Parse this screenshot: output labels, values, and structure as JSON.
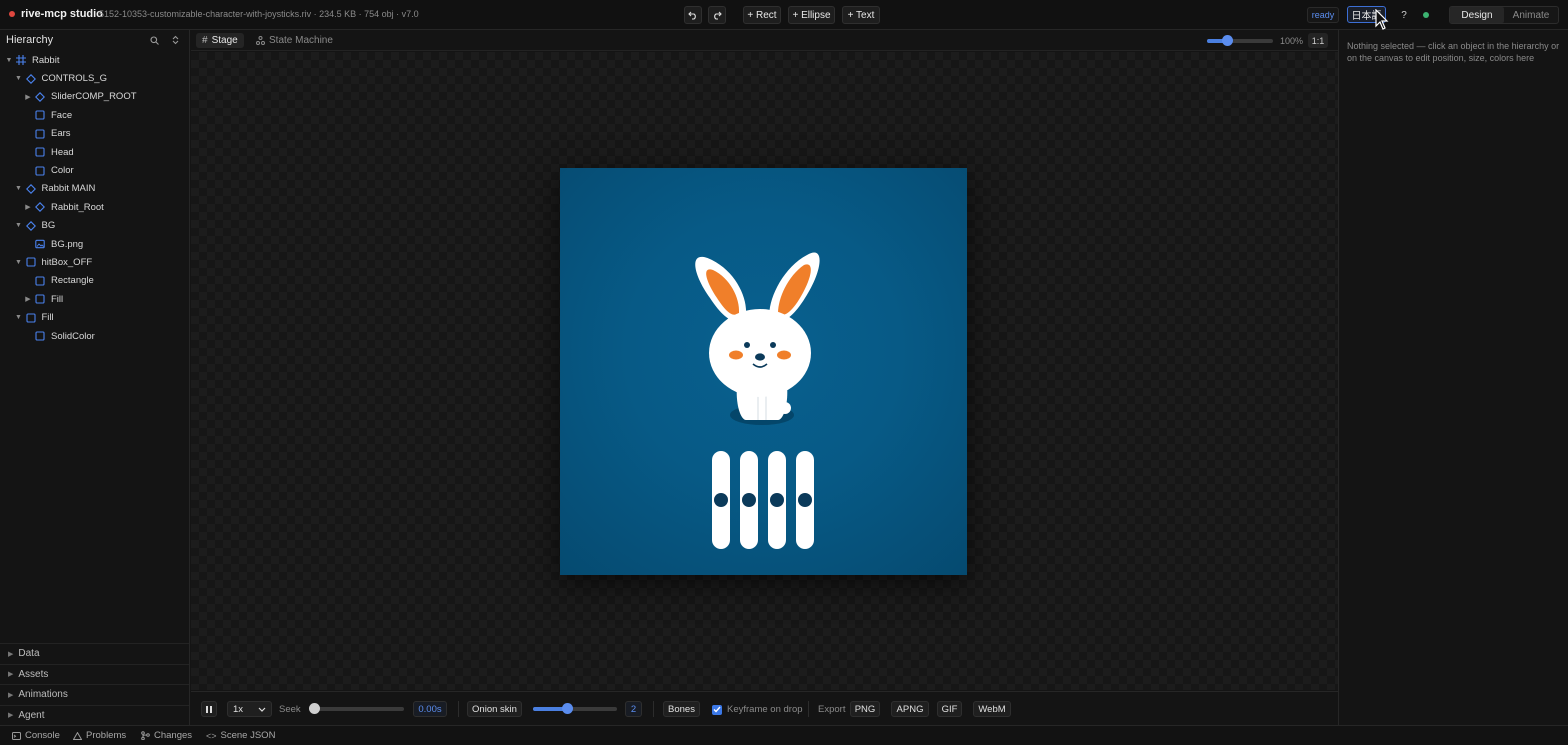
{
  "app": {
    "name": "rive-mcp studio",
    "file_info": "5152-10353-customizable-character-with-joysticks.riv · 234.5 KB · 754 obj · v7.0"
  },
  "toolbar": {
    "undo_icon": "undo-icon",
    "redo_icon": "redo-icon",
    "add_rect": "+ Rect",
    "add_ellipse": "+ Ellipse",
    "add_text": "+ Text",
    "status": "ready",
    "language": "日本語",
    "help": "?",
    "status_color": "#3cb371"
  },
  "modes": {
    "design": "Design",
    "animate": "Animate",
    "active": "Design"
  },
  "hierarchy": {
    "title": "Hierarchy",
    "items": [
      {
        "label": "Rabbit",
        "depth": 0,
        "toggle": "open",
        "icon": "artboard-icon"
      },
      {
        "label": "CONTROLS_G",
        "depth": 1,
        "toggle": "open",
        "icon": "group-icon"
      },
      {
        "label": "SliderCOMP_ROOT",
        "depth": 2,
        "toggle": "closed",
        "icon": "group-icon"
      },
      {
        "label": "Face",
        "depth": 2,
        "toggle": "none",
        "icon": "shape-icon"
      },
      {
        "label": "Ears",
        "depth": 2,
        "toggle": "none",
        "icon": "shape-icon"
      },
      {
        "label": "Head",
        "depth": 2,
        "toggle": "none",
        "icon": "shape-icon"
      },
      {
        "label": "Color",
        "depth": 2,
        "toggle": "none",
        "icon": "shape-icon"
      },
      {
        "label": "Rabbit MAIN",
        "depth": 1,
        "toggle": "open",
        "icon": "group-icon"
      },
      {
        "label": "Rabbit_Root",
        "depth": 2,
        "toggle": "closed",
        "icon": "group-icon"
      },
      {
        "label": "BG",
        "depth": 1,
        "toggle": "open",
        "icon": "group-icon"
      },
      {
        "label": "BG.png",
        "depth": 2,
        "toggle": "none",
        "icon": "image-icon"
      },
      {
        "label": "hitBox_OFF",
        "depth": 1,
        "toggle": "open",
        "icon": "shape-icon"
      },
      {
        "label": "Rectangle",
        "depth": 2,
        "toggle": "none",
        "icon": "shape-icon"
      },
      {
        "label": "Fill",
        "depth": 2,
        "toggle": "closed",
        "icon": "shape-icon"
      },
      {
        "label": "Fill",
        "depth": 1,
        "toggle": "open",
        "icon": "shape-icon"
      },
      {
        "label": "SolidColor",
        "depth": 2,
        "toggle": "none",
        "icon": "shape-icon"
      }
    ]
  },
  "sections": [
    "Data",
    "Assets",
    "Animations",
    "Agent"
  ],
  "stage": {
    "tabs": {
      "stage": "Stage",
      "state_machine": "State Machine"
    },
    "zoom": "100%",
    "zoom_fraction": 0.3,
    "one_to_one": "1:1",
    "artboard_color": "#075a86",
    "slider_count": 4
  },
  "playback": {
    "speed": "1x",
    "seek_label": "Seek",
    "seek_value": "0.00s",
    "seek_fraction": 0,
    "onion_skin": "Onion skin",
    "onion_value": "2",
    "onion_fraction": 0.4,
    "bones": "Bones",
    "keyframe_on_drop": "Keyframe on drop",
    "keyframe_checked": true,
    "export_label": "Export",
    "formats": [
      "PNG",
      "APNG",
      "GIF",
      "WebM"
    ]
  },
  "inspector": {
    "hint": "Nothing selected — click an object in the hierarchy or on the canvas to edit position, size, colors here"
  },
  "statusbar": {
    "console": "Console",
    "problems": "Problems",
    "changes": "Changes",
    "scene_json": "Scene JSON"
  }
}
